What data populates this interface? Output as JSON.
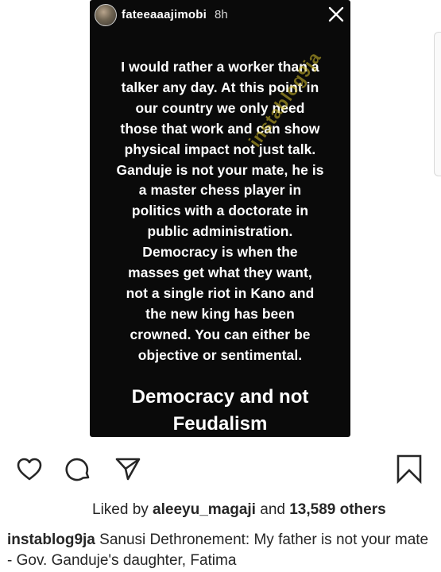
{
  "story": {
    "username": "fateeaaajimobi",
    "time": "8h",
    "text_lines": [
      "I would rather a worker than a",
      "talker any day. At this point in",
      "our country we only need",
      "those that work and can show",
      "physical impact not just talk.",
      "Ganduje is not your mate, he is",
      "a master chess player in",
      "politics with a doctorate in",
      "public administration.",
      "Democracy is when the",
      "masses get what they want,",
      "not a single riot in Kano and",
      "the new king has been",
      "crowned.  You can either be",
      "objective or sentimental."
    ],
    "headline_lines": [
      "Democracy and not",
      "Feudalism"
    ],
    "watermark": "instablog9ja"
  },
  "actions": {
    "like_icon": "heart-outline",
    "comment_icon": "speech-bubble-outline",
    "share_icon": "paper-plane-outline",
    "save_icon": "bookmark-outline"
  },
  "likes": {
    "prefix": "Liked by ",
    "user": "aleeyu_magaji",
    "connector": " and ",
    "count": "13,589 others"
  },
  "caption": {
    "user": "instablog9ja",
    "text": "Sanusi Dethronement: My father is not your mate - Gov. Ganduje's daughter, Fatima"
  }
}
